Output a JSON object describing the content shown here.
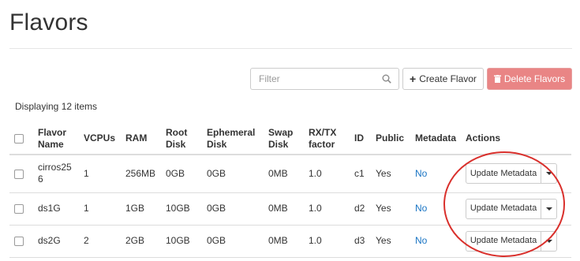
{
  "page": {
    "title": "Flavors"
  },
  "toolbar": {
    "filter_placeholder": "Filter",
    "search_icon": "search-icon",
    "create_label": "Create Flavor",
    "create_icon": "plus-icon",
    "delete_label": "Delete Flavors",
    "delete_icon": "trash-icon",
    "delete_color": "#e98585"
  },
  "table": {
    "count_text": "Displaying 12 items",
    "headers": {
      "name_line1": "Flavor",
      "name_line2": "Name",
      "vcpus": "VCPUs",
      "ram": "RAM",
      "root_line1": "Root",
      "root_line2": "Disk",
      "eph_line1": "Ephemeral",
      "eph_line2": "Disk",
      "swap_line1": "Swap",
      "swap_line2": "Disk",
      "rxtx_line1": "RX/TX",
      "rxtx_line2": "factor",
      "id": "ID",
      "public": "Public",
      "metadata": "Metadata",
      "actions": "Actions"
    },
    "rows": [
      {
        "name_line1": "cirros25",
        "name_line2": "6",
        "vcpus": "1",
        "ram": "256MB",
        "root_disk": "0GB",
        "ephemeral_disk": "0GB",
        "swap_disk": "0MB",
        "rxtx": "1.0",
        "id": "c1",
        "public": "Yes",
        "metadata": "No",
        "action": "Update Metadata"
      },
      {
        "name": "ds1G",
        "vcpus": "1",
        "ram": "1GB",
        "root_disk": "10GB",
        "ephemeral_disk": "0GB",
        "swap_disk": "0MB",
        "rxtx": "1.0",
        "id": "d2",
        "public": "Yes",
        "metadata": "No",
        "action": "Update Metadata"
      },
      {
        "name": "ds2G",
        "vcpus": "2",
        "ram": "2GB",
        "root_disk": "10GB",
        "ephemeral_disk": "0GB",
        "swap_disk": "0MB",
        "rxtx": "1.0",
        "id": "d3",
        "public": "Yes",
        "metadata": "No",
        "action": "Update Metadata"
      }
    ]
  },
  "colors": {
    "link": "#1a75c4",
    "annotation_circle": "#d9302c"
  }
}
